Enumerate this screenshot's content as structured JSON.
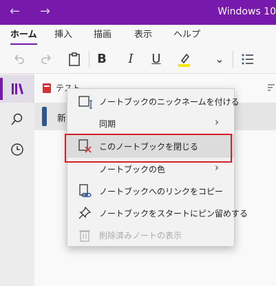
{
  "window": {
    "title": "Windows 10"
  },
  "nav": {
    "back": "←",
    "forward": "→"
  },
  "ribbon": {
    "tabs": [
      {
        "label": "ホーム",
        "active": true
      },
      {
        "label": "挿入"
      },
      {
        "label": "描画"
      },
      {
        "label": "表示"
      },
      {
        "label": "ヘルプ"
      }
    ]
  },
  "toolbar": {
    "bold": "B",
    "italic": "I",
    "underline": "U",
    "chevron": "⌄",
    "highlight_color": "#f7e600"
  },
  "sidebar": {
    "notebook_name": "テスト",
    "section_row_label": "新"
  },
  "context_menu": {
    "items": [
      {
        "label": "ノートブックのニックネームを付ける",
        "icon": "rename-notebook-icon"
      },
      {
        "label": "同期",
        "submenu": true
      },
      {
        "label": "このノートブックを閉じる",
        "icon": "close-notebook-icon",
        "highlighted": true
      },
      {
        "label": "ノートブックの色",
        "submenu": true
      },
      {
        "label": "ノートブックへのリンクをコピー",
        "icon": "copy-link-icon"
      },
      {
        "label": "ノートブックをスタートにピン留めする",
        "icon": "pin-icon"
      },
      {
        "label": "削除済みノートの表示",
        "icon": "trash-icon",
        "disabled": true
      }
    ]
  },
  "colors": {
    "brand": "#7719aa",
    "highlight_box": "#d62028",
    "notebook_red": "#d13438",
    "notebook_blue": "#2b579a"
  }
}
